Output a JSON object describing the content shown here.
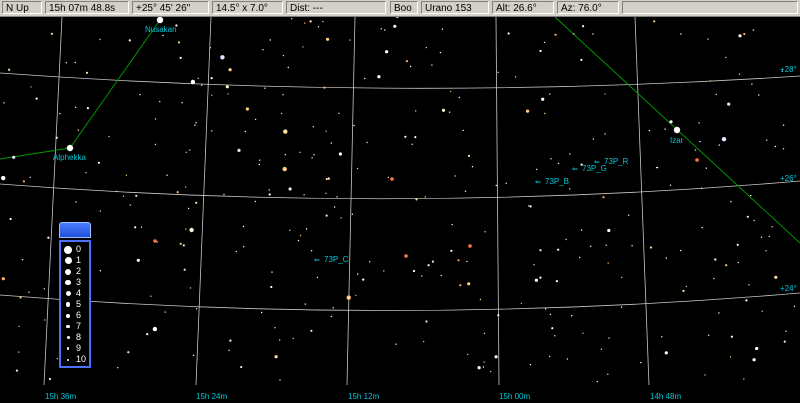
{
  "status_bar": [
    {
      "name": "orientation-field",
      "text": "N Up"
    },
    {
      "name": "right-ascension-field",
      "text": "15h 07m 48.8s"
    },
    {
      "name": "declination-field",
      "text": "+25° 45' 26\""
    },
    {
      "name": "field-of-view-field",
      "text": "14.5° x 7.0°"
    },
    {
      "name": "distance-field",
      "text": "Dist: ---"
    },
    {
      "name": "constellation-field",
      "text": "Boo"
    },
    {
      "name": "atlas-page-field",
      "text": "Urano 153"
    },
    {
      "name": "altitude-field",
      "text": "Alt: 26.6°"
    },
    {
      "name": "azimuth-field",
      "text": "Az: 76.0°"
    }
  ],
  "ra_labels": [
    "15h 36m",
    "15h 24m",
    "15h 12m",
    "15h 00m",
    "14h 48m"
  ],
  "dec_labels": [
    "+28°",
    "+26°",
    "+24°"
  ],
  "star_names": [
    "Nusakan",
    "Alphekka",
    "Izar"
  ],
  "object_labels": [
    "73P_R",
    "73P_G",
    "73P_B",
    "73P_C"
  ],
  "legend": {
    "magnitudes": [
      "0",
      "1",
      "2",
      "3",
      "4",
      "5",
      "6",
      "7",
      "8",
      "9",
      "10"
    ]
  },
  "colors": {
    "grid": "#c8c8c8",
    "label": "#00c8d8",
    "constellation_line": "#00a000",
    "legend_border": "#4f6fff"
  }
}
